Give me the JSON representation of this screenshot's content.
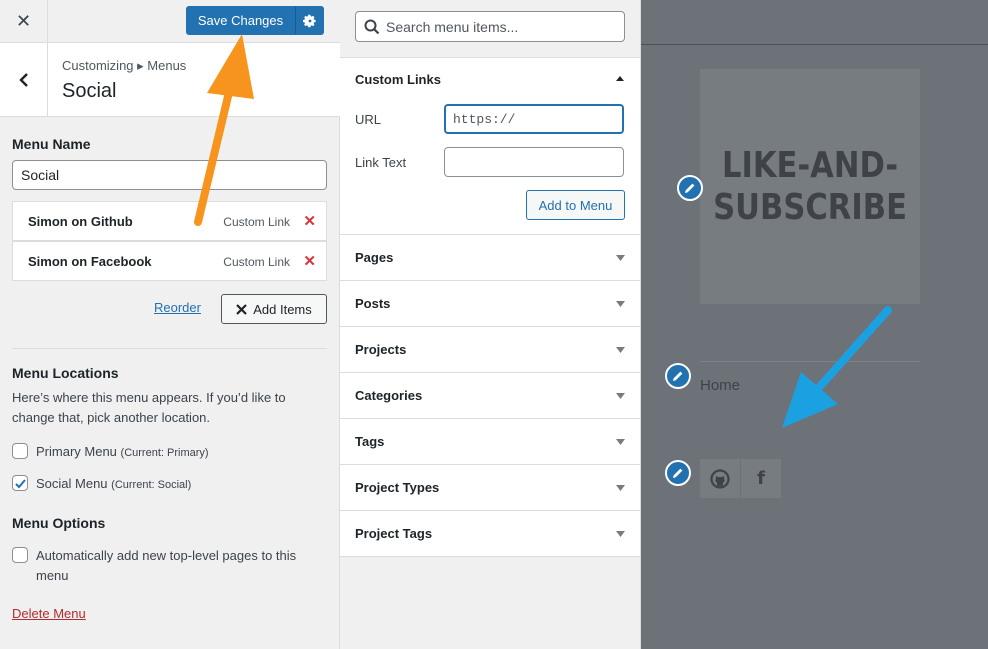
{
  "topbar": {
    "close_glyph": "✕",
    "save_label": "Save Changes",
    "settings_icon": "gear-icon"
  },
  "header": {
    "breadcrumb": "Customizing ▸ Menus",
    "title": "Social"
  },
  "menu": {
    "name_label": "Menu Name",
    "name_value": "Social",
    "items": [
      {
        "title": "Simon on Github",
        "type": "Custom Link"
      },
      {
        "title": "Simon on Facebook",
        "type": "Custom Link"
      }
    ],
    "delete_glyph": "✕",
    "reorder_label": "Reorder",
    "add_items_label": "Add Items"
  },
  "locations": {
    "heading": "Menu Locations",
    "description": "Here’s where this menu appears. If you’d like to change that, pick another location.",
    "options": [
      {
        "label": "Primary Menu",
        "current": "(Current: Primary)",
        "checked": false
      },
      {
        "label": "Social Menu",
        "current": "(Current: Social)",
        "checked": true
      }
    ]
  },
  "options": {
    "heading": "Menu Options",
    "auto_add_label": "Automatically add new top-level pages to this menu"
  },
  "delete_menu_label": "Delete Menu",
  "add_panel": {
    "search_placeholder": "Search menu items...",
    "custom_links": {
      "title": "Custom Links",
      "url_label": "URL",
      "url_value": "https://",
      "link_text_label": "Link Text",
      "link_text_value": "",
      "add_button": "Add to Menu"
    },
    "sections": [
      "Pages",
      "Posts",
      "Projects",
      "Categories",
      "Tags",
      "Project Types",
      "Project Tags"
    ]
  },
  "preview": {
    "logo_line1": "LIKE-AND-",
    "logo_line2": "SUBSCRIBE",
    "home_link": "Home",
    "facebook_letter": "f"
  },
  "colors": {
    "primary_blue": "#2271b1",
    "delete_red": "#d63638",
    "annotation_orange": "#f7941d",
    "annotation_blue": "#1ba1e2"
  }
}
